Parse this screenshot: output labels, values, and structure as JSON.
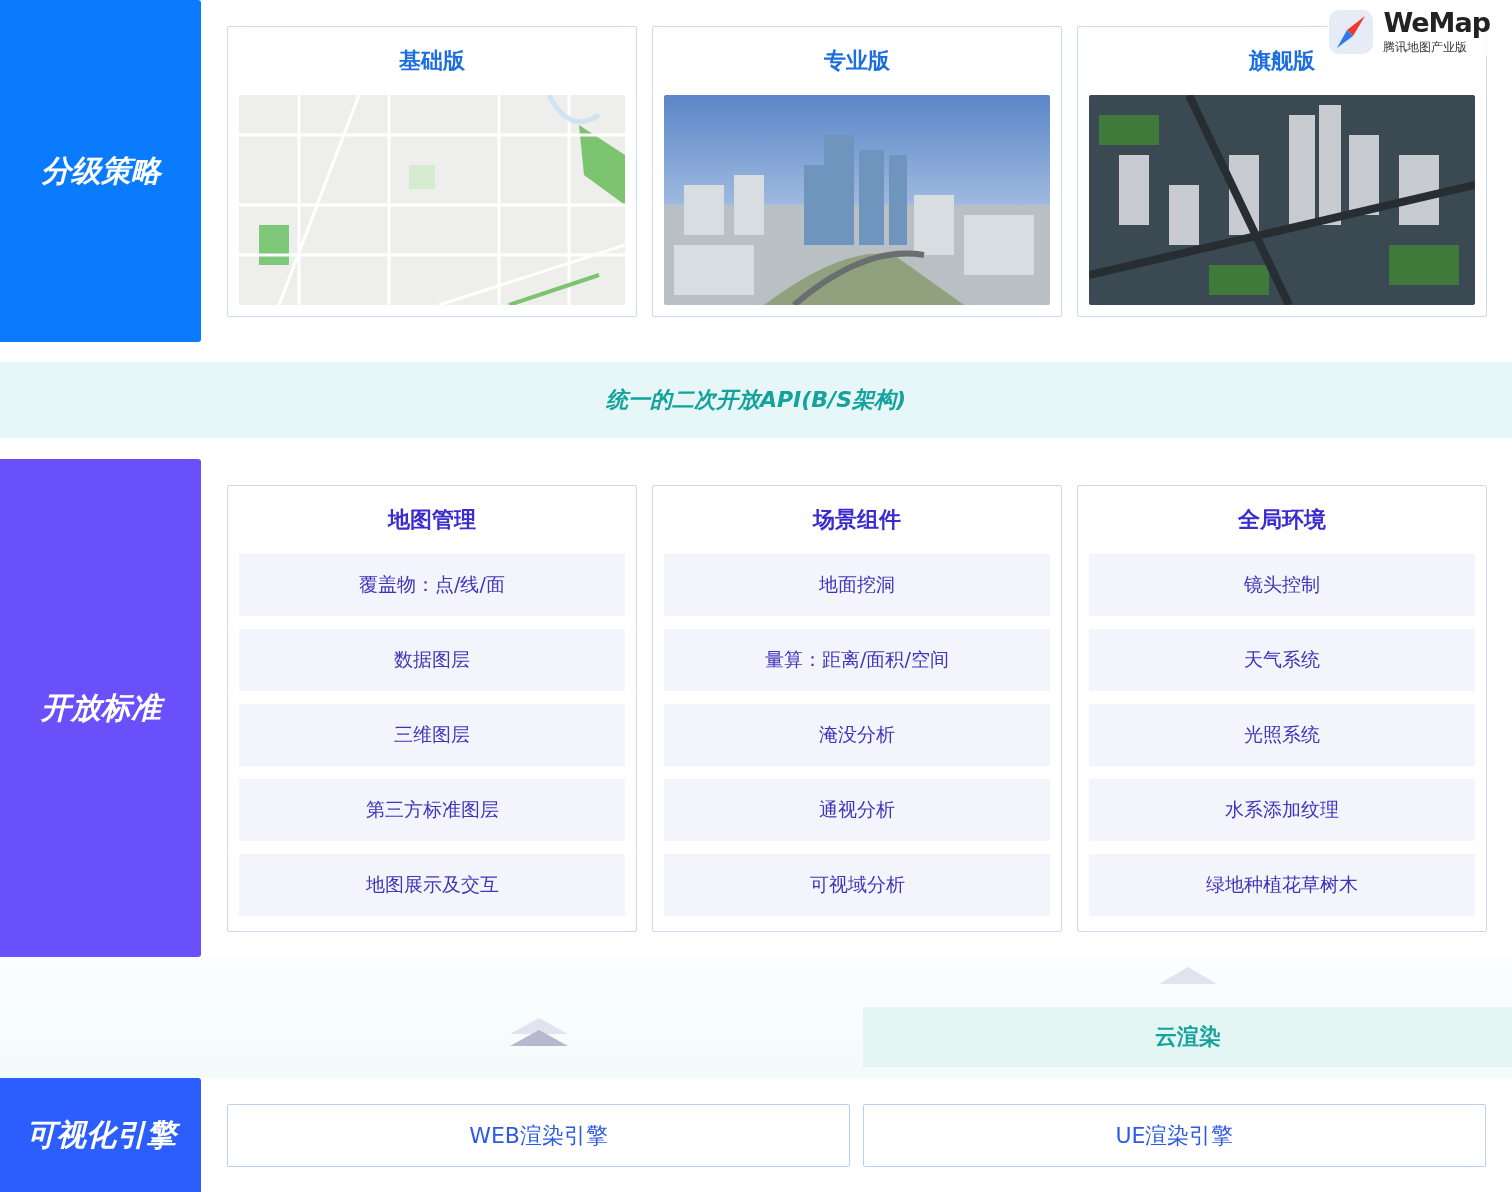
{
  "logo": {
    "name": "WeMap",
    "subtitle": "腾讯地图产业版"
  },
  "strategy": {
    "label": "分级策略",
    "cards": [
      {
        "title": "基础版",
        "kind": "flat-map"
      },
      {
        "title": "专业版",
        "kind": "city-3d"
      },
      {
        "title": "旗舰版",
        "kind": "city-aerial"
      }
    ]
  },
  "api_band": {
    "label": "统一的二次开放API(B/S架构)"
  },
  "standards": {
    "label": "开放标准",
    "cards": [
      {
        "title": "地图管理",
        "items": [
          "覆盖物：点/线/面",
          "数据图层",
          "三维图层",
          "第三方标准图层",
          "地图展示及交互"
        ]
      },
      {
        "title": "场景组件",
        "items": [
          "地面挖洞",
          "量算：距离/面积/空间",
          "淹没分析",
          "通视分析",
          "可视域分析"
        ]
      },
      {
        "title": "全局环境",
        "items": [
          "镜头控制",
          "天气系统",
          "光照系统",
          "水系添加纹理",
          "绿地种植花草树木"
        ]
      }
    ]
  },
  "cloud_render": {
    "label": "云渲染"
  },
  "engines": {
    "label": "可视化引擎",
    "boxes": [
      "WEB渲染引擎",
      "UE渲染引擎"
    ]
  }
}
